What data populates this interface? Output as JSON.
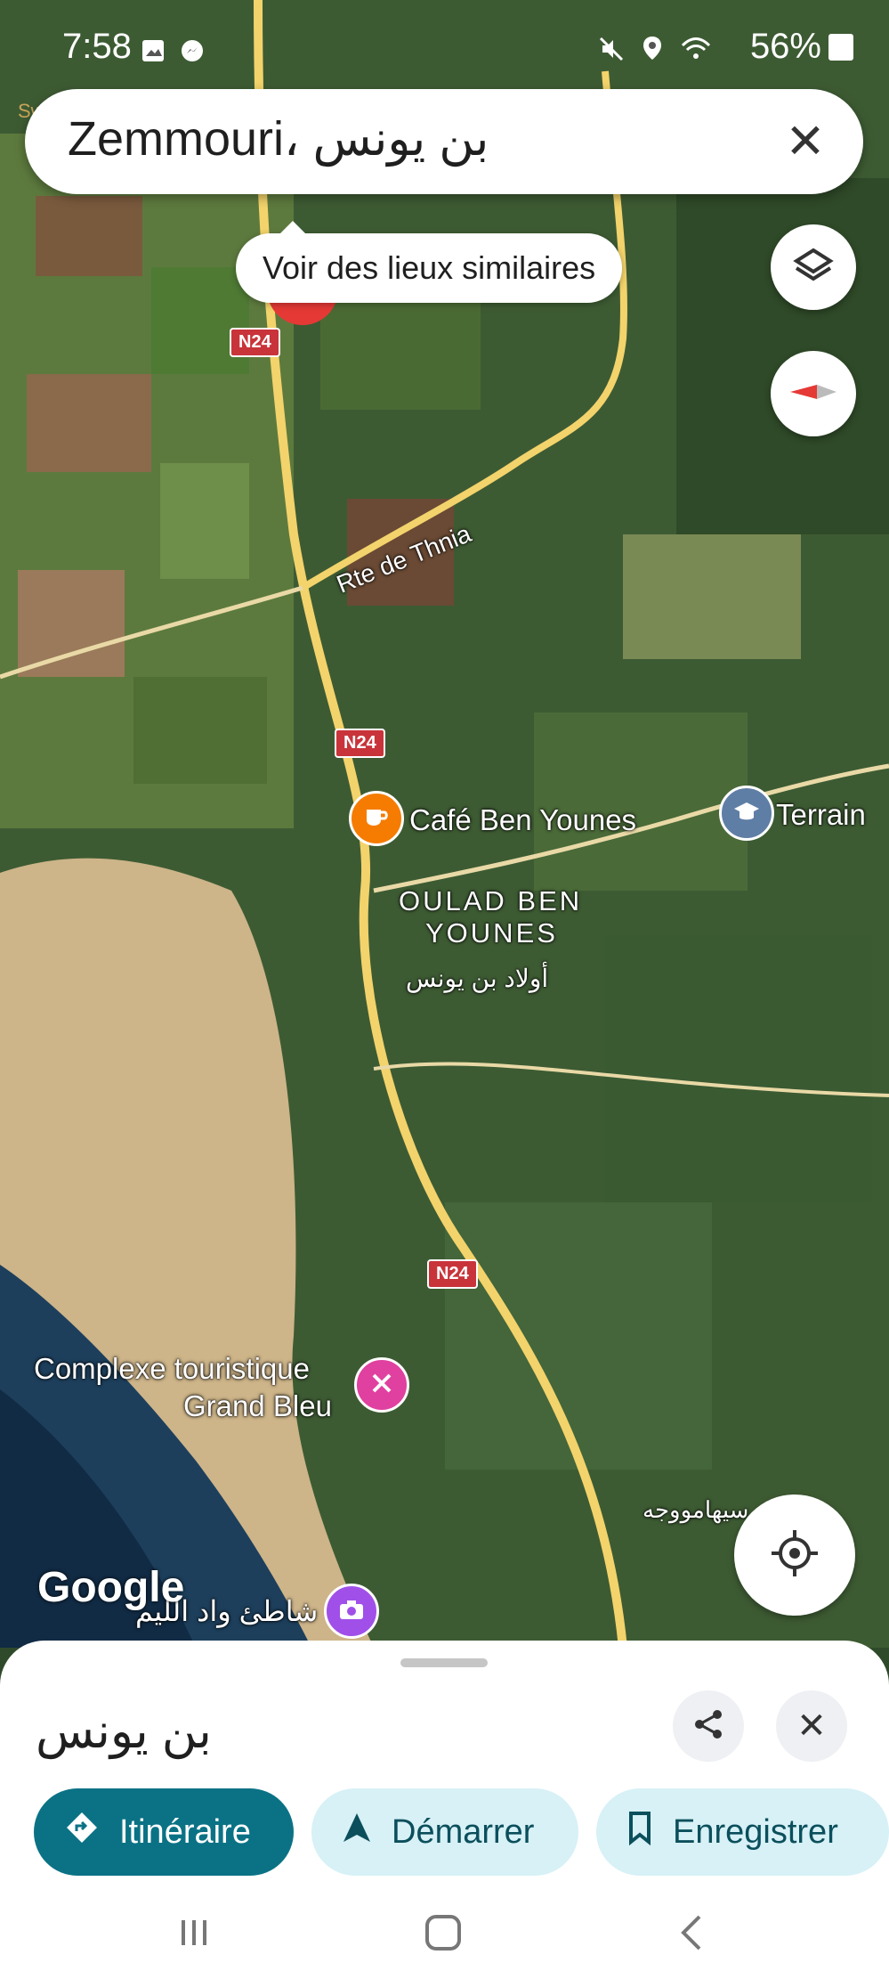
{
  "status_bar": {
    "time": "7:58",
    "battery": "56%"
  },
  "watermark": "Swiga | سويقة",
  "search": {
    "query": "Zemmouri، بن يونس"
  },
  "tooltip": {
    "label": "Voir des lieux similaires"
  },
  "map": {
    "roads": [
      {
        "shield": "N24"
      },
      {
        "shield": "N24"
      },
      {
        "shield": "N24"
      }
    ],
    "road_name": "Rte de Thnia",
    "places": {
      "cafe": "Café Ben Younes",
      "terrain": "Terrain",
      "town_line1": "OULAD BEN",
      "town_line2": "YOUNES",
      "town_arabic": "أولاد بن يونس",
      "resort_line1": "Complexe touristique",
      "resort_line2": "Grand Bleu",
      "beach_arabic": "شاطئ واد الليم",
      "east_arabic": "سيهامووجه"
    },
    "attribution": "Google"
  },
  "sheet": {
    "title": "بن يونس",
    "actions": {
      "directions": "Itinéraire",
      "start": "Démarrer",
      "save": "Enregistrer"
    }
  },
  "colors": {
    "accent": "#0b7285",
    "chip": "#d7f1f6",
    "road": "#f3d36b",
    "shield": "#c8343a"
  }
}
